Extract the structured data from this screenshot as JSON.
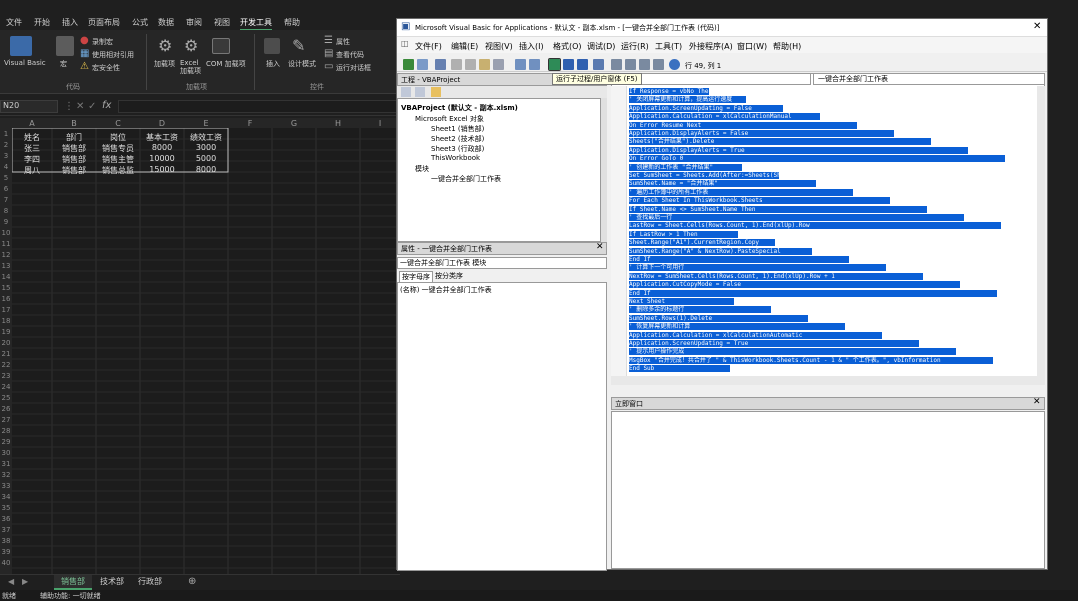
{
  "excel": {
    "ribbon_tabs": [
      "文件",
      "开始",
      "插入",
      "页面布局",
      "公式",
      "数据",
      "审阅",
      "视图",
      "开发工具",
      "帮助"
    ],
    "active_tab": "开发工具",
    "ribbon": {
      "visual_basic": "Visual Basic",
      "macros": "宏",
      "record_macro": "录制宏",
      "use_relative": "使用相对引用",
      "macro_security": "宏安全性",
      "addins": "加载项",
      "excel_addins": "Excel 加载项",
      "com_addins": "COM 加载项",
      "insert": "插入",
      "design_mode": "设计模式",
      "properties": "属性",
      "view_code": "查看代码",
      "run_dialog": "运行对话框",
      "group_code": "代码",
      "group_addins": "加载项",
      "group_controls": "控件"
    },
    "name_box": "N20",
    "fx": "fx",
    "columns": [
      "A",
      "B",
      "C",
      "D",
      "E",
      "F",
      "G",
      "H",
      "I",
      "J",
      "K",
      "L"
    ],
    "table": {
      "headers": [
        "姓名",
        "部门",
        "岗位",
        "基本工资",
        "绩效工资"
      ],
      "rows": [
        [
          "张三",
          "销售部",
          "销售专员",
          "8000",
          "3000"
        ],
        [
          "李四",
          "销售部",
          "销售主管",
          "10000",
          "5000"
        ],
        [
          "周八",
          "销售部",
          "销售总监",
          "15000",
          "8000"
        ]
      ]
    },
    "sheet_tabs": [
      "销售部",
      "技术部",
      "行政部"
    ],
    "active_sheet": "销售部",
    "status_left": "就绪",
    "status_access": "辅助功能: 一切就绪"
  },
  "vbe": {
    "title": "Microsoft Visual Basic for Applications - 默认文 - 副本.xlsm - [一键合并全部门工作表 (代码)]",
    "menus": [
      "文件(F)",
      "编辑(E)",
      "视图(V)",
      "插入(I)",
      "格式(O)",
      "调试(D)",
      "运行(R)",
      "工具(T)",
      "外接程序(A)",
      "窗口(W)",
      "帮助(H)"
    ],
    "cursor_pos": "行 49, 列 1",
    "tooltip": "运行子过程/用户窗体 (F5)",
    "general_dropdown": "(通用)",
    "proc_dropdown": "一键合并全部门工作表",
    "project_title": "工程 - VBAProject",
    "tree": [
      "VBAProject (默认文 - 副本.xlsm)",
      "Microsoft Excel 对象",
      "Sheet1 (销售部)",
      "Sheet2 (技术部)",
      "Sheet3 (行政部)",
      "ThisWorkbook",
      "模块",
      "一键合并全部门工作表"
    ],
    "properties_title": "属性 - 一键合并全部门工作表",
    "properties_combo": "一键合并全部门工作表 模块",
    "prop_tab_alpha": "按字母序",
    "prop_tab_cat": "按分类序",
    "prop_name_row": "(名称) 一键合并全部门工作表",
    "immediate_title": "立即窗口",
    "code_lines": [
      "If Response = vbNo Then Exit Sub  ' 如果用户选择否，则退出子程序",
      "' 关闭屏幕更新和计算，提高运行速度",
      "Application.ScreenUpdating = False",
      "Application.Calculation = xlCalculationManual",
      "On Error Resume Next",
      "Application.DisplayAlerts = False",
      "Sheets(\"合并结果\").Delete",
      "Application.DisplayAlerts = True",
      "On Error GoTo 0",
      "' 创建新的工作表 \"合并结果\"",
      "Set SumSheet = Sheets.Add(After:=Sheets(Sheets.Count))",
      "SumSheet.Name = \"合并结果\"",
      "' 遍历工作簿中的所有工作表",
      "For Each Sheet In ThisWorkbook.Sheets",
      "    If Sheet.Name <> SumSheet.Name Then",
      "        ' 查找最后一行",
      "        LastRow = Sheet.Cells(Rows.Count, 1).End(xlUp).Row",
      "        If LastRow > 1 Then",
      "            Sheet.Range(\"A1\").CurrentRegion.Copy",
      "            SumSheet.Range(\"A\" & NextRow).PasteSpecial",
      "        End If",
      "        ' 计算下一个可用行",
      "        NextRow = SumSheet.Cells(Rows.Count, 1).End(xlUp).Row + 1",
      "        Application.CutCopyMode = False",
      "    End If",
      "Next Sheet",
      "' 删除多余的标题行",
      "SumSheet.Rows(1).Delete",
      "' 恢复屏幕更新和计算",
      "Application.Calculation = xlCalculationAutomatic",
      "Application.ScreenUpdating = True",
      "' 提示用户操作完成",
      "MsgBox \"合并完成！共合并了 \" & ThisWorkbook.Sheets.Count - 1 & \" 个工作表。\", vbInformation",
      "End Sub"
    ]
  }
}
